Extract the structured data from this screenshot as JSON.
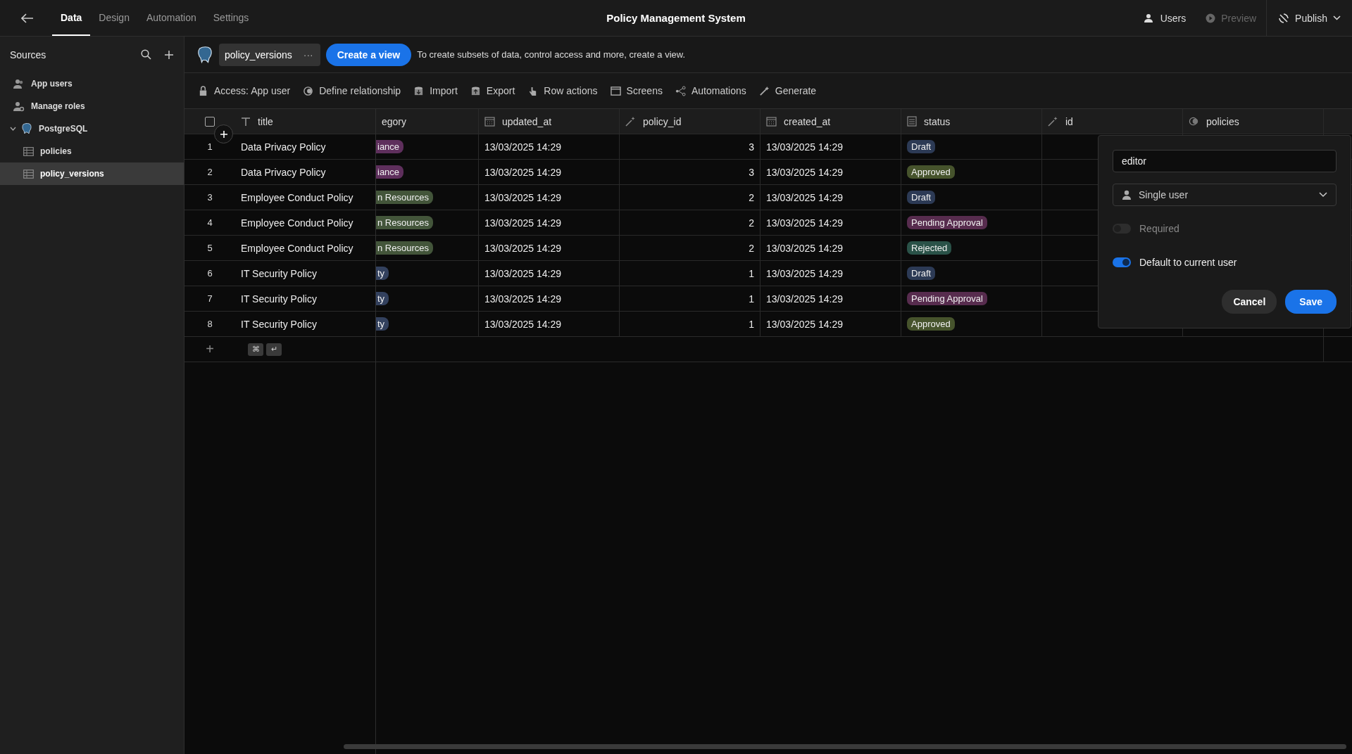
{
  "topbar": {
    "tabs": [
      {
        "label": "Data",
        "selected": true
      },
      {
        "label": "Design",
        "selected": false
      },
      {
        "label": "Automation",
        "selected": false
      },
      {
        "label": "Settings",
        "selected": false
      }
    ],
    "title": "Policy Management System",
    "actions": [
      {
        "label": "Users",
        "kind": "users",
        "disabled": false
      },
      {
        "label": "Preview",
        "kind": "preview",
        "disabled": true
      }
    ],
    "publish": "Publish"
  },
  "sidebar": {
    "title": "Sources",
    "items": [
      {
        "label": "App users",
        "kind": "users",
        "selected": false
      },
      {
        "label": "Manage roles",
        "kind": "roles",
        "selected": false
      },
      {
        "label": "PostgreSQL",
        "kind": "database",
        "selected": false,
        "expanded": true,
        "children": [
          {
            "label": "policies",
            "kind": "table",
            "selected": false
          },
          {
            "label": "policy_versions",
            "kind": "table",
            "selected": true
          }
        ]
      }
    ]
  },
  "sourcebar": {
    "table_name": "policy_versions",
    "more": "···",
    "create_button": "Create a view",
    "hint": "To create subsets of data, control access and more, create a view."
  },
  "toolbar": [
    {
      "label": "Access: App user",
      "kind": "lock"
    },
    {
      "label": "Define relationship",
      "kind": "relationship"
    },
    {
      "label": "Import",
      "kind": "import"
    },
    {
      "label": "Export",
      "kind": "export"
    },
    {
      "label": "Row actions",
      "kind": "hand"
    },
    {
      "label": "Screens",
      "kind": "screen"
    },
    {
      "label": "Automations",
      "kind": "automation"
    },
    {
      "label": "Generate",
      "kind": "wand"
    }
  ],
  "table": {
    "columns": [
      {
        "name": "title",
        "kind": "text"
      },
      {
        "name": "egory",
        "kind": "none"
      },
      {
        "name": "updated_at",
        "kind": "date"
      },
      {
        "name": "policy_id",
        "kind": "auto"
      },
      {
        "name": "created_at",
        "kind": "date"
      },
      {
        "name": "status",
        "kind": "options"
      },
      {
        "name": "id",
        "kind": "auto"
      },
      {
        "name": "policies",
        "kind": "relationship"
      }
    ],
    "rows": [
      {
        "number": "1",
        "title": "Data Privacy Policy",
        "category": {
          "text": "iance",
          "color": "#5e2f5c"
        },
        "updated_at": "13/03/2025 14:29",
        "policy_id": "3",
        "created_at": "13/03/2025 14:29",
        "status": {
          "text": "Draft",
          "color": "#2c3a55"
        }
      },
      {
        "number": "2",
        "title": "Data Privacy Policy",
        "category": {
          "text": "iance",
          "color": "#5e2f5c"
        },
        "updated_at": "13/03/2025 14:29",
        "policy_id": "3",
        "created_at": "13/03/2025 14:29",
        "status": {
          "text": "Approved",
          "color": "#46532c"
        }
      },
      {
        "number": "3",
        "title": "Employee Conduct Policy",
        "category": {
          "text": "n Resources",
          "color": "#43553a"
        },
        "updated_at": "13/03/2025 14:29",
        "policy_id": "2",
        "created_at": "13/03/2025 14:29",
        "status": {
          "text": "Draft",
          "color": "#2c3a55"
        }
      },
      {
        "number": "4",
        "title": "Employee Conduct Policy",
        "category": {
          "text": "n Resources",
          "color": "#43553a"
        },
        "updated_at": "13/03/2025 14:29",
        "policy_id": "2",
        "created_at": "13/03/2025 14:29",
        "status": {
          "text": "Pending Approval",
          "color": "#572c4e"
        }
      },
      {
        "number": "5",
        "title": "Employee Conduct Policy",
        "category": {
          "text": "n Resources",
          "color": "#43553a"
        },
        "updated_at": "13/03/2025 14:29",
        "policy_id": "2",
        "created_at": "13/03/2025 14:29",
        "status": {
          "text": "Rejected",
          "color": "#2a5248"
        }
      },
      {
        "number": "6",
        "title": "IT Security Policy",
        "category": {
          "text": "ty",
          "color": "#33415e"
        },
        "updated_at": "13/03/2025 14:29",
        "policy_id": "1",
        "created_at": "13/03/2025 14:29",
        "status": {
          "text": "Draft",
          "color": "#2c3a55"
        }
      },
      {
        "number": "7",
        "title": "IT Security Policy",
        "category": {
          "text": "ty",
          "color": "#33415e"
        },
        "updated_at": "13/03/2025 14:29",
        "policy_id": "1",
        "created_at": "13/03/2025 14:29",
        "status": {
          "text": "Pending Approval",
          "color": "#572c4e"
        }
      },
      {
        "number": "8",
        "title": "IT Security Policy",
        "category": {
          "text": "ty",
          "color": "#33415e"
        },
        "updated_at": "13/03/2025 14:29",
        "policy_id": "1",
        "created_at": "13/03/2025 14:29",
        "status": {
          "text": "Approved",
          "color": "#46532c"
        }
      }
    ],
    "select_all": {
      "checked": false
    },
    "add_row": {
      "plus": "+",
      "keys": [
        "⌘",
        "↵"
      ]
    }
  },
  "popup": {
    "name_value": "editor",
    "type": "Single user",
    "toggles": [
      {
        "label": "Required",
        "on": false,
        "disabled": true
      },
      {
        "label": "Default to current user",
        "on": true,
        "disabled": false
      }
    ],
    "cancel": "Cancel",
    "save": "Save"
  }
}
